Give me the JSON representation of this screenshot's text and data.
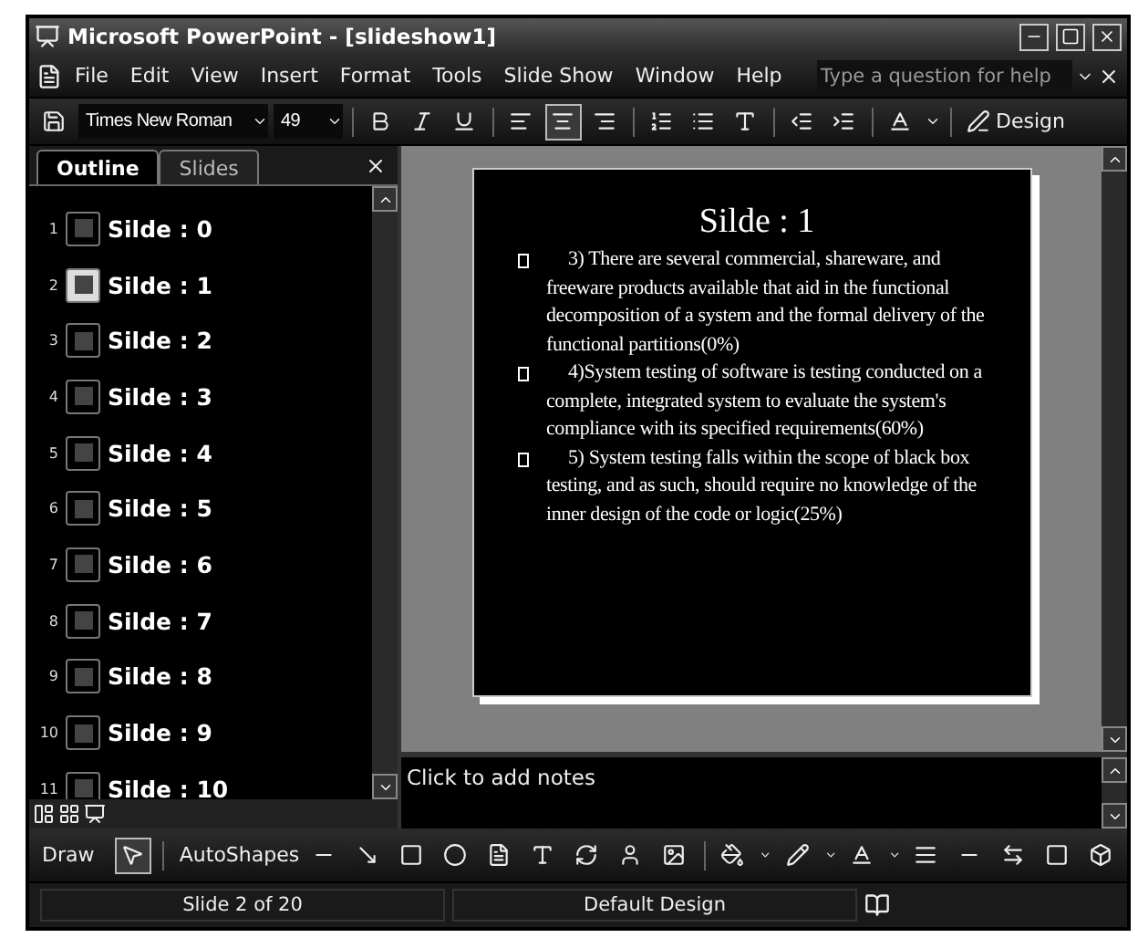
{
  "window": {
    "title": "Microsoft PowerPoint - [slideshow1]"
  },
  "menu": [
    "File",
    "Edit",
    "View",
    "Insert",
    "Format",
    "Tools",
    "Slide Show",
    "Window",
    "Help"
  ],
  "help_search": {
    "placeholder": "Type a question for help"
  },
  "formatting_toolbar": {
    "font": "Times New Roman",
    "size": "49",
    "design": "Design",
    "align_center_selected": true
  },
  "pane_tabs": [
    {
      "label": "Outline",
      "selected": true
    },
    {
      "label": "Slides",
      "selected": false
    }
  ],
  "outline": [
    {
      "number": "1",
      "label": "Silde : 0",
      "selected": false
    },
    {
      "number": "2",
      "label": "Silde : 1",
      "selected": true
    },
    {
      "number": "3",
      "label": "Silde : 2",
      "selected": false
    },
    {
      "number": "4",
      "label": "Silde : 3",
      "selected": false
    },
    {
      "number": "5",
      "label": "Silde : 4",
      "selected": false
    },
    {
      "number": "6",
      "label": "Silde : 5",
      "selected": false
    },
    {
      "number": "7",
      "label": "Silde : 6",
      "selected": false
    },
    {
      "number": "8",
      "label": "Silde : 7",
      "selected": false
    },
    {
      "number": "9",
      "label": "Silde : 8",
      "selected": false
    },
    {
      "number": "10",
      "label": "Silde : 9",
      "selected": false
    },
    {
      "number": "11",
      "label": "Silde : 10",
      "selected": false
    }
  ],
  "slide": {
    "title": "Silde : 1",
    "bullets": [
      "3) There are several commercial, shareware, and freeware products available that aid in the functional decomposition of a system and the formal delivery of the functional partitions(0%)",
      "4)System testing of software is testing conducted on a complete, integrated system to evaluate the system's compliance with its specified requirements(60%)",
      "5) System testing falls within the scope of black box testing, and as such, should require no knowledge of the inner design of the code or logic(25%)"
    ]
  },
  "notes": {
    "placeholder": "Click to add notes"
  },
  "drawing_toolbar": {
    "draw": "Draw",
    "autoshapes": "AutoShapes"
  },
  "status_bar": {
    "slide": "Slide 2 of 20",
    "design": "Default Design"
  }
}
